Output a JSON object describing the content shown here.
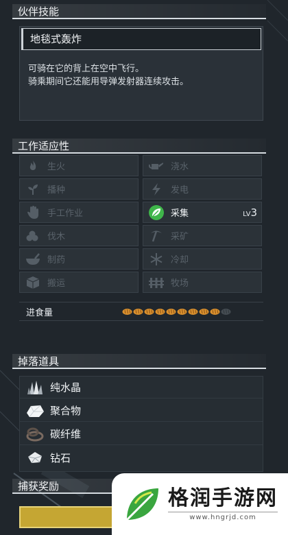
{
  "partner_skill": {
    "section_title": "伙伴技能",
    "skill_name": "地毯式轰炸",
    "description_lines": [
      "可骑在它的背上在空中飞行。",
      "骑乘期间它还能用导弹发射器连续攻击。"
    ]
  },
  "work_suitability": {
    "section_title": "工作适应性",
    "items": [
      {
        "label": "生火",
        "icon": "fire-icon",
        "active": false
      },
      {
        "label": "浇水",
        "icon": "watering-can-icon",
        "active": false
      },
      {
        "label": "播种",
        "icon": "sprout-icon",
        "active": false
      },
      {
        "label": "发电",
        "icon": "lightning-icon",
        "active": false
      },
      {
        "label": "手工作业",
        "icon": "hand-icon",
        "active": false
      },
      {
        "label": "采集",
        "icon": "leaf-icon",
        "active": true,
        "level_prefix": "LV",
        "level": "3"
      },
      {
        "label": "伐木",
        "icon": "logs-icon",
        "active": false
      },
      {
        "label": "采矿",
        "icon": "pickaxe-icon",
        "active": false
      },
      {
        "label": "制药",
        "icon": "mortar-icon",
        "active": false
      },
      {
        "label": "冷却",
        "icon": "snowflake-icon",
        "active": false
      },
      {
        "label": "搬运",
        "icon": "box-icon",
        "active": false
      },
      {
        "label": "牧场",
        "icon": "fence-icon",
        "active": false
      }
    ],
    "food": {
      "label": "进食量",
      "filled": 9,
      "total": 10
    }
  },
  "drops": {
    "section_title": "掉落道具",
    "items": [
      {
        "label": "纯水晶",
        "icon": "crystal-icon"
      },
      {
        "label": "聚合物",
        "icon": "polymer-icon"
      },
      {
        "label": "碳纤维",
        "icon": "carbon-fiber-icon"
      },
      {
        "label": "钻石",
        "icon": "diamond-icon"
      }
    ]
  },
  "capture_reward": {
    "section_title": "捕获奖励"
  },
  "watermark": {
    "name": "格润手游网",
    "url": "www.hngrjd.com"
  },
  "colors": {
    "accent_green": "#3fb54a",
    "bread": "#d9902e",
    "reward_gold": "#c5a633"
  }
}
